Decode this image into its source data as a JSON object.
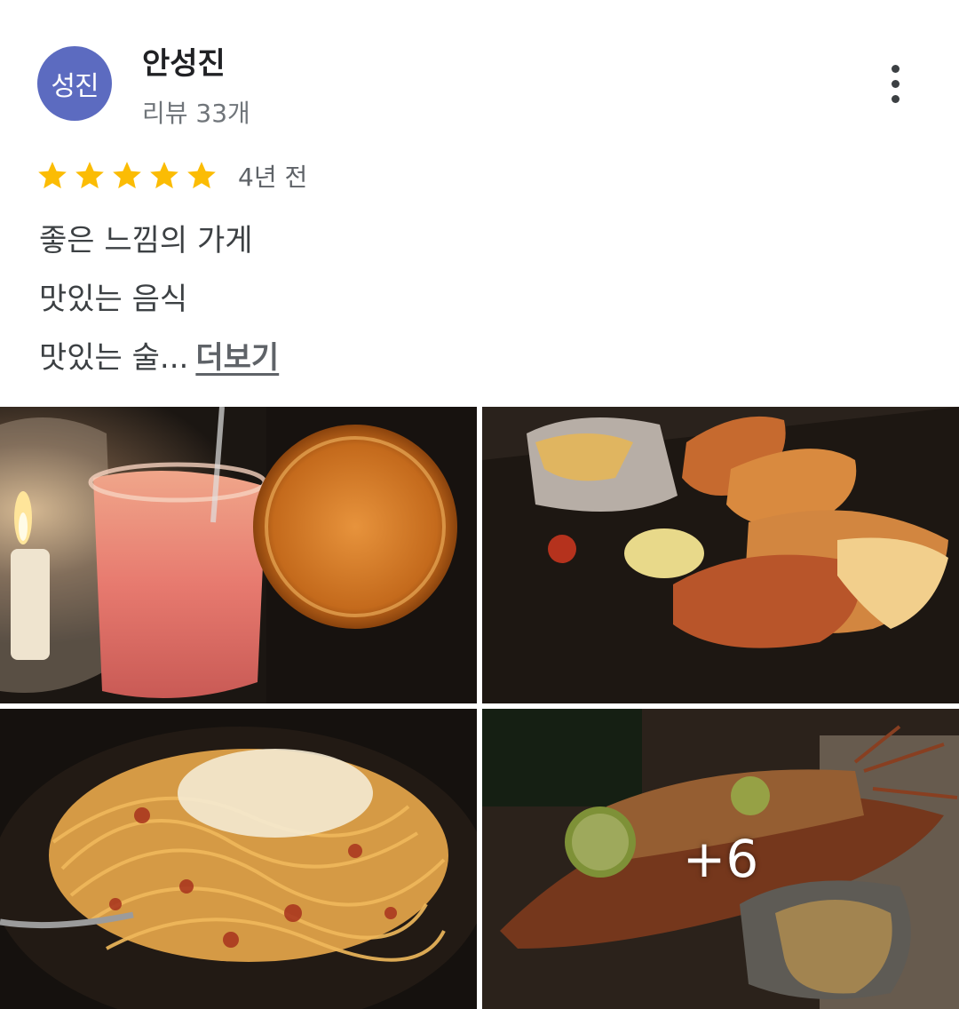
{
  "reviewer": {
    "avatar_initials": "성진",
    "avatar_color": "#5c6bc0",
    "name": "안성진",
    "review_count": "리뷰 33개"
  },
  "rating": {
    "stars": 5,
    "star_color": "#fbbc04",
    "date": "4년 전"
  },
  "review": {
    "lines": [
      "좋은 느낌의 가게",
      "맛있는 음식",
      "맛있는 술..."
    ],
    "more_label": "더보기"
  },
  "photos": {
    "items": [
      {
        "icon": "cocktail-photo"
      },
      {
        "icon": "grilled-seafood-photo"
      },
      {
        "icon": "spaghetti-photo"
      },
      {
        "icon": "lobster-photo"
      }
    ],
    "more_count_label": "+6"
  }
}
